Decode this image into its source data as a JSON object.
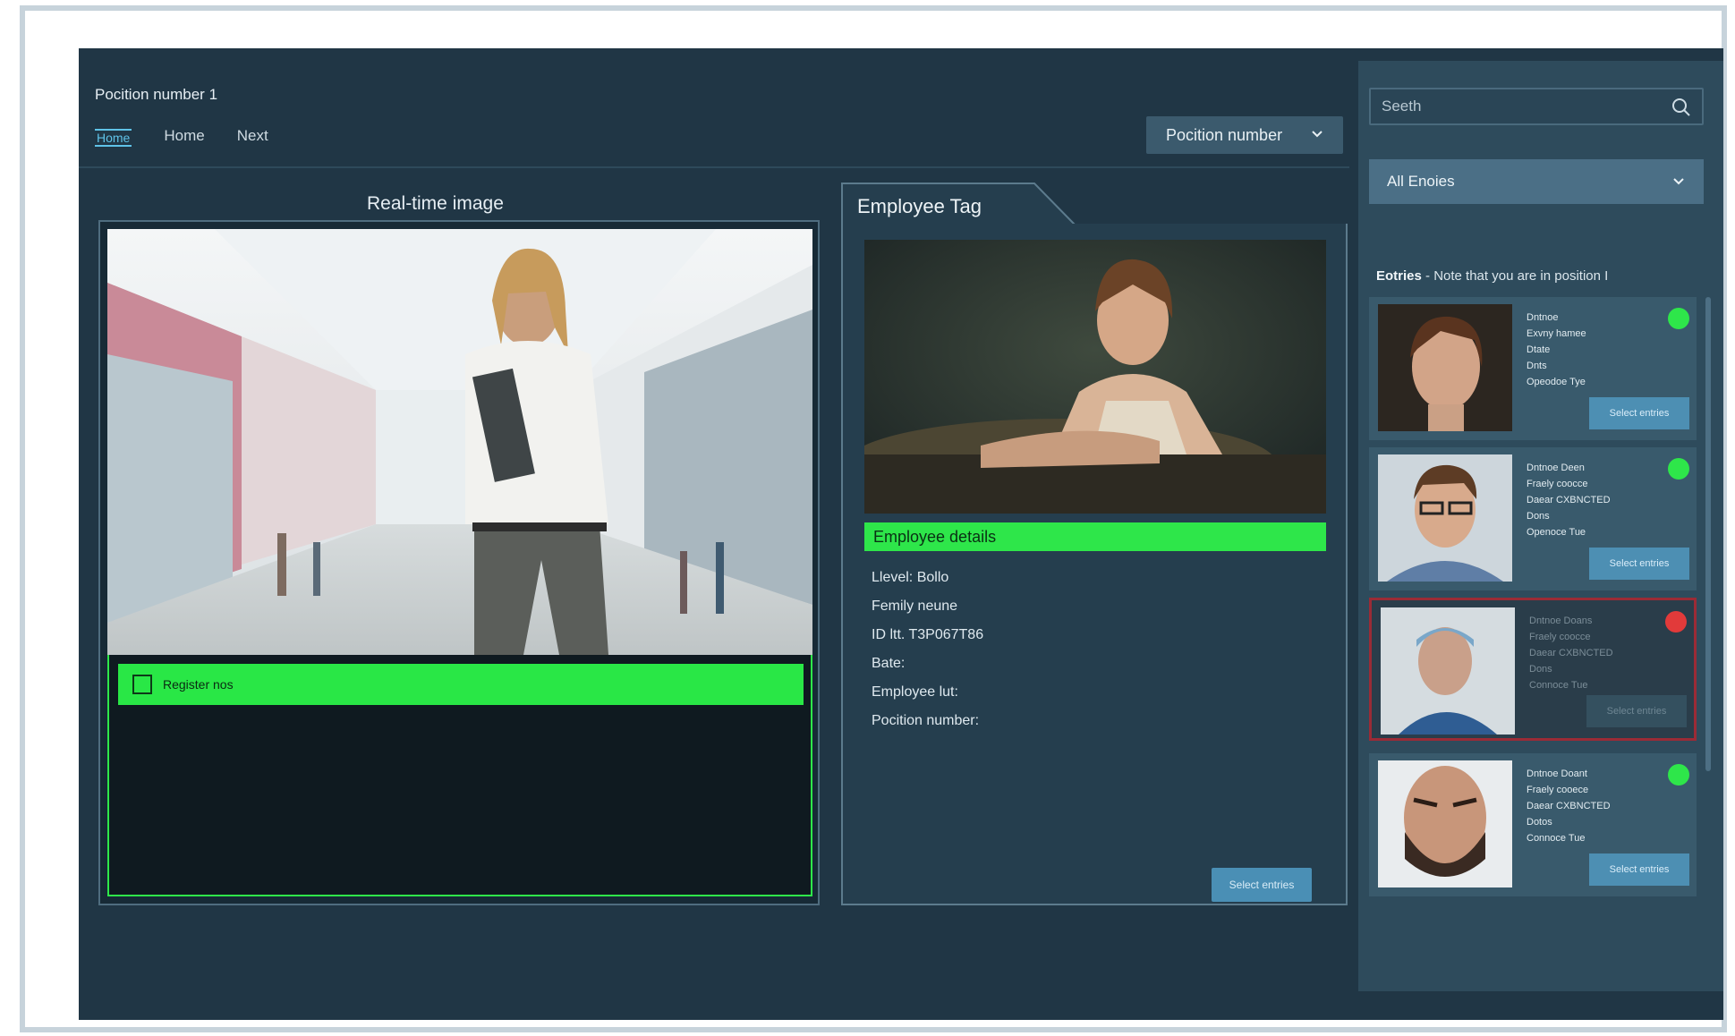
{
  "header": {
    "position_title": "Pocition number 1",
    "nav": [
      "Home",
      "Home",
      "Next"
    ],
    "position_select": "Pocition number"
  },
  "realtime": {
    "title": "Real-time image",
    "status_label": "Register nos"
  },
  "employee": {
    "tab_title": "Employee Tag",
    "details_label": "Employee details",
    "fields": [
      "Llevel: Bollo",
      "Femily neune",
      "ID ltt. T3P067T86",
      "Bate:",
      "Employee lut:",
      "Pocition number:"
    ],
    "action_label": "Select entries"
  },
  "sidebar": {
    "search_placeholder": "Seeth",
    "filter_label": "All Enoies",
    "entries_title": "Eotries",
    "entries_note": "- Note that you are in position I",
    "cards": [
      {
        "lines": [
          "Dntnoe",
          "Exvny hamee",
          "Dtate",
          "Dnts",
          "Opeodoe Tye"
        ],
        "status_color": "#2ee64a",
        "button": "Select entries"
      },
      {
        "lines": [
          "Dntnoe Deen",
          "Fraely coocce",
          "Daear CXBNCTED",
          "Dons",
          "Openoce Tue"
        ],
        "status_color": "#2ee64a",
        "button": "Select entries"
      },
      {
        "lines": [
          "Dntnoe Doans",
          "Fraely coocce",
          "Daear CXBNCTED",
          "Dons",
          "Connoce Tue"
        ],
        "status_color": "#e23a3a",
        "button": "Select entries"
      },
      {
        "lines": [
          "Dntnoe Doant",
          "Fraely cooece",
          "Daear CXBNCTED",
          "Dotos",
          "Connoce Tue"
        ],
        "status_color": "#2ee64a",
        "button": "Select entries"
      }
    ]
  },
  "colors": {
    "accent_green": "#2ee64a",
    "alert_red": "#e23a3a",
    "panel": "#203645"
  }
}
